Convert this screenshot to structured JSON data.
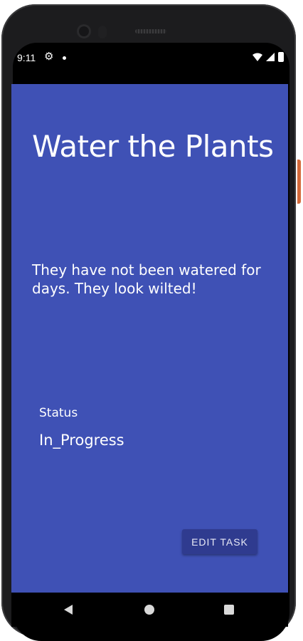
{
  "statusbar": {
    "time": "9:11",
    "icons": [
      "gear-icon",
      "dot-icon",
      "wifi-icon",
      "signal-icon",
      "battery-icon"
    ]
  },
  "task": {
    "title": "Water the Plants",
    "description": "They have not been watered for days. They look wilted!",
    "status_label": "Status",
    "status_value": "In_Progress"
  },
  "actions": {
    "edit_label": "EDIT TASK"
  },
  "navbar": {
    "icons": [
      "back-icon",
      "home-icon",
      "recents-icon"
    ]
  },
  "colors": {
    "background": "#3f51b5",
    "button": "#2f3b8f",
    "text": "#ffffff"
  }
}
